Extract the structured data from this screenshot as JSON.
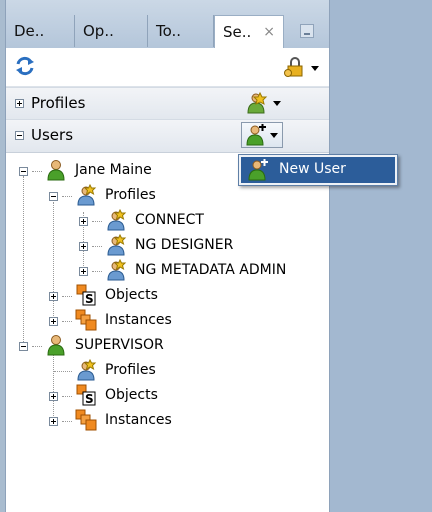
{
  "tabs": [
    {
      "label": "De.."
    },
    {
      "label": "Op.."
    },
    {
      "label": "To.."
    },
    {
      "label": "Se..",
      "active": true
    }
  ],
  "tab_close_glyph": "×",
  "toolbar": {
    "refresh_icon": "refresh-icon",
    "security_icon": "lock-icon"
  },
  "sections": {
    "profiles": {
      "label": "Profiles",
      "expanded": false,
      "action_icon": "profile-add-icon"
    },
    "users": {
      "label": "Users",
      "expanded": true,
      "action_icon": "user-add-icon"
    }
  },
  "menu": {
    "items": [
      {
        "label": "New User",
        "icon": "new-user-icon"
      }
    ]
  },
  "tree": {
    "users": [
      {
        "label": "Jane Maine",
        "icon": "user-icon",
        "children": [
          {
            "label": "Profiles",
            "icon": "profile-icon",
            "children": [
              {
                "label": "CONNECT",
                "icon": "profile-icon"
              },
              {
                "label": "NG DESIGNER",
                "icon": "profile-icon"
              },
              {
                "label": "NG METADATA ADMIN",
                "icon": "profile-icon"
              }
            ]
          },
          {
            "label": "Objects",
            "icon": "objects-icon"
          },
          {
            "label": "Instances",
            "icon": "instances-icon"
          }
        ]
      },
      {
        "label": "SUPERVISOR",
        "icon": "user-icon",
        "children": [
          {
            "label": "Profiles",
            "icon": "profile-icon"
          },
          {
            "label": "Objects",
            "icon": "objects-icon"
          },
          {
            "label": "Instances",
            "icon": "instances-icon"
          }
        ]
      }
    ]
  },
  "colors": {
    "accent": "#2c5d9a",
    "background": "#a3b8d0"
  }
}
